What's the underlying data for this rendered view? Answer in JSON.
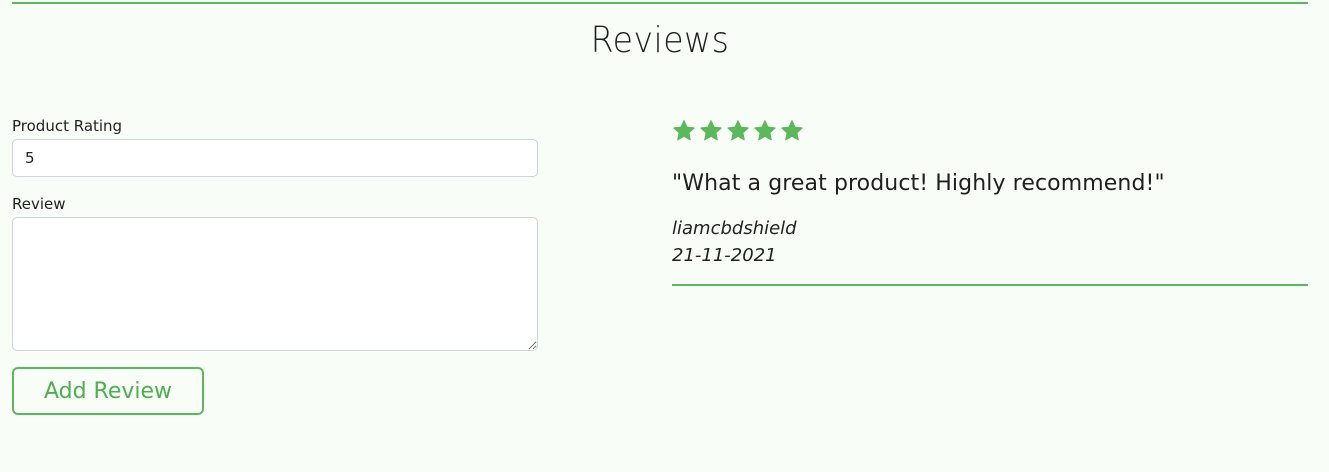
{
  "section": {
    "title": "Reviews"
  },
  "form": {
    "rating_label": "Product Rating",
    "rating_value": "5",
    "review_label": "Review",
    "review_value": "",
    "submit_label": "Add Review"
  },
  "reviews": [
    {
      "rating": 5,
      "max_rating": 5,
      "text": "\"What a great product! Highly recommend!\"",
      "author": "liamcbdshield",
      "date": "21-11-2021"
    }
  ],
  "colors": {
    "accent": "#5cb85c",
    "background": "#f8fdf7"
  },
  "icons": {
    "star": "star-icon"
  }
}
